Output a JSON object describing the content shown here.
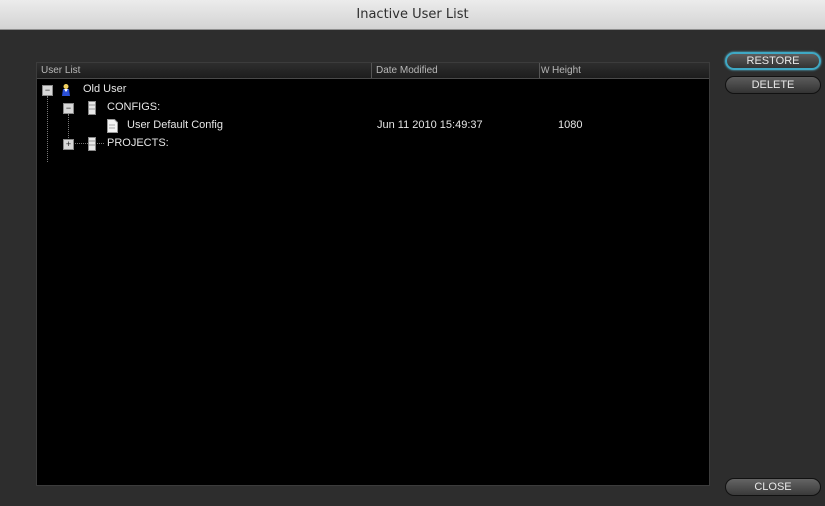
{
  "window": {
    "title": "Inactive User List"
  },
  "table": {
    "columns": [
      "User List",
      "Date Modified",
      "Height"
    ],
    "width_marker": "W",
    "rows": [
      {
        "label": "Old User",
        "icon": "user-icon",
        "expanded": true,
        "date": "",
        "height": ""
      },
      {
        "label": "CONFIGS:",
        "icon": "folder-icon",
        "expanded": true,
        "date": "",
        "height": ""
      },
      {
        "label": "User Default Config",
        "icon": "document-icon",
        "date": "Jun 11 2010 15:49:37",
        "height": "1080"
      },
      {
        "label": "PROJECTS:",
        "icon": "folder-icon",
        "expanded": false,
        "date": "",
        "height": ""
      }
    ]
  },
  "buttons": {
    "restore": "RESTORE",
    "delete": "DELETE",
    "close": "CLOSE"
  },
  "toggles": {
    "expanded": "−",
    "collapsed": "+"
  },
  "colors": {
    "accent": "#3fa8c4"
  }
}
